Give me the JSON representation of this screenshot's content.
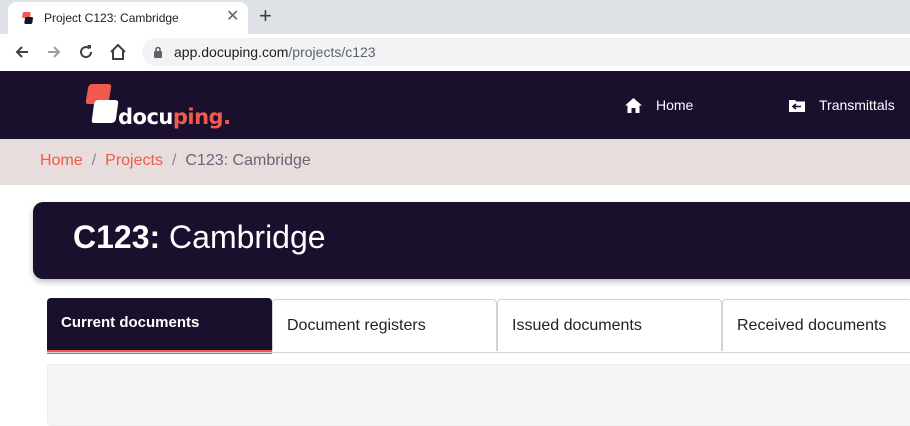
{
  "browser": {
    "tab_title": "Project C123: Cambridge",
    "new_tab": "+",
    "close_tab": "✕",
    "url_host": "app.docuping.com",
    "url_path": "/projects/c123"
  },
  "brand": {
    "logo_main": "docu",
    "logo_accent": "ping.",
    "primary_color": "#1b0f2e",
    "accent_color": "#ef5a4c"
  },
  "nav": {
    "items": [
      {
        "label": "Home",
        "icon": "home-icon"
      },
      {
        "label": "Transmittals",
        "icon": "folder-transmittals-icon"
      }
    ]
  },
  "breadcrumb": {
    "items": [
      "Home",
      "Projects",
      "C123: Cambridge"
    ],
    "separator": "/"
  },
  "project": {
    "code": "C123:",
    "name": "Cambridge"
  },
  "tabs": [
    {
      "label": "Current documents",
      "active": true
    },
    {
      "label": "Document registers",
      "active": false
    },
    {
      "label": "Issued documents",
      "active": false
    },
    {
      "label": "Received documents",
      "active": false
    }
  ]
}
